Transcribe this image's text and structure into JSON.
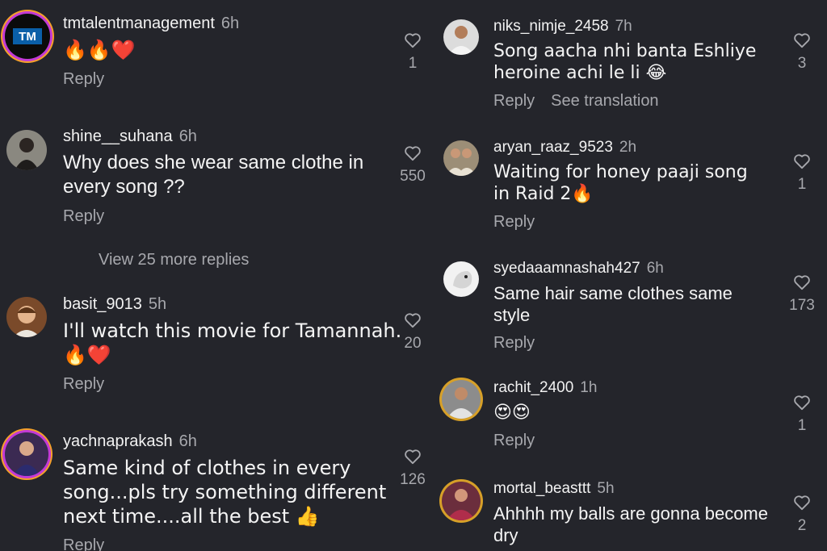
{
  "left": [
    {
      "user": "tmtalentmanagement",
      "time": "6h",
      "text": "🔥🔥❤️",
      "likes": "1",
      "reply": "Reply",
      "avatar": "TM"
    },
    {
      "user": "shine__suhana",
      "time": "6h",
      "text": "Why does she wear same clothe in every song ??",
      "likes": "550",
      "reply": "Reply"
    },
    {
      "user": "basit_9013",
      "time": "5h",
      "text": "I'll watch this movie for Tamannah. 🔥❤️",
      "likes": "20",
      "reply": "Reply"
    },
    {
      "user": "yachnaprakash",
      "time": "6h",
      "text": "Same kind of clothes in every song...pls try something different next time....all the best 👍",
      "likes": "126",
      "reply": "Reply"
    }
  ],
  "view_more": "View 25 more replies",
  "right": [
    {
      "user": "niks_nimje_2458",
      "time": "7h",
      "text": "Song aacha nhi banta Eshliye heroine achi le li 😂",
      "likes": "3",
      "reply": "Reply",
      "translate": "See translation"
    },
    {
      "user": "aryan_raaz_9523",
      "time": "2h",
      "text": "Waiting for honey paaji song in Raid 2🔥",
      "likes": "1",
      "reply": "Reply"
    },
    {
      "user": "syedaaamnashah427",
      "time": "6h",
      "text": "Same hair same clothes same style",
      "likes": "173",
      "reply": "Reply"
    },
    {
      "user": "rachit_2400",
      "time": "1h",
      "text": "😍😍",
      "likes": "1",
      "reply": "Reply"
    },
    {
      "user": "mortal_beasttt",
      "time": "5h",
      "text": "Ahhhh my balls are gonna become dry",
      "likes": "2"
    }
  ]
}
